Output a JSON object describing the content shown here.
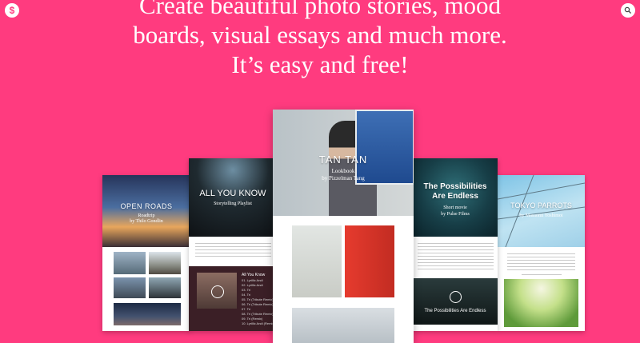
{
  "app": {
    "logo_letter": "$"
  },
  "headline": {
    "line1": "Create beautiful photo stories, mood",
    "line2": "boards, visual essays and much more.",
    "line3": "It’s easy and free!"
  },
  "stories": {
    "open_roads": {
      "title": "OPEN ROADS",
      "type": "Roadtrip",
      "author": "by Thilo Gondlin"
    },
    "all_you_know": {
      "title": "ALL YOU KNOW",
      "type": "Storytelling Playlist"
    },
    "tan_tan": {
      "title": "TAN TAN",
      "type": "Lookbook",
      "author": "by Pizzelman Tang"
    },
    "possibilities": {
      "title_line1": "The Possibilities",
      "title_line2": "Are Endless",
      "type": "Short movie",
      "author": "by Pulse Films",
      "video_caption": "The Possibilities Are Endless"
    },
    "tokyo_parrots": {
      "title": "TOKYO PARROTS",
      "author": "by Masaomi Yoshimoi"
    }
  },
  "playlist": {
    "header": "All You Know",
    "tracks": [
      "01. Lyrillic Andi",
      "02. Lyrillic Andi",
      "03. Tri",
      "04. Tri",
      "05. Tri (Tribute Remix)",
      "06. Tri (Tribute Remix)",
      "07. Tri",
      "08. Tri (Tribute Remix)",
      "09. Tri (Remix)",
      "10. Lyrillic Andi (Remix)"
    ]
  },
  "colors": {
    "background": "#ff3b7f",
    "headline": "#ffffff",
    "card": "#ffffff"
  },
  "icons": {
    "logo": "dollar-logo-icon",
    "search": "search-icon",
    "play": "play-icon"
  }
}
